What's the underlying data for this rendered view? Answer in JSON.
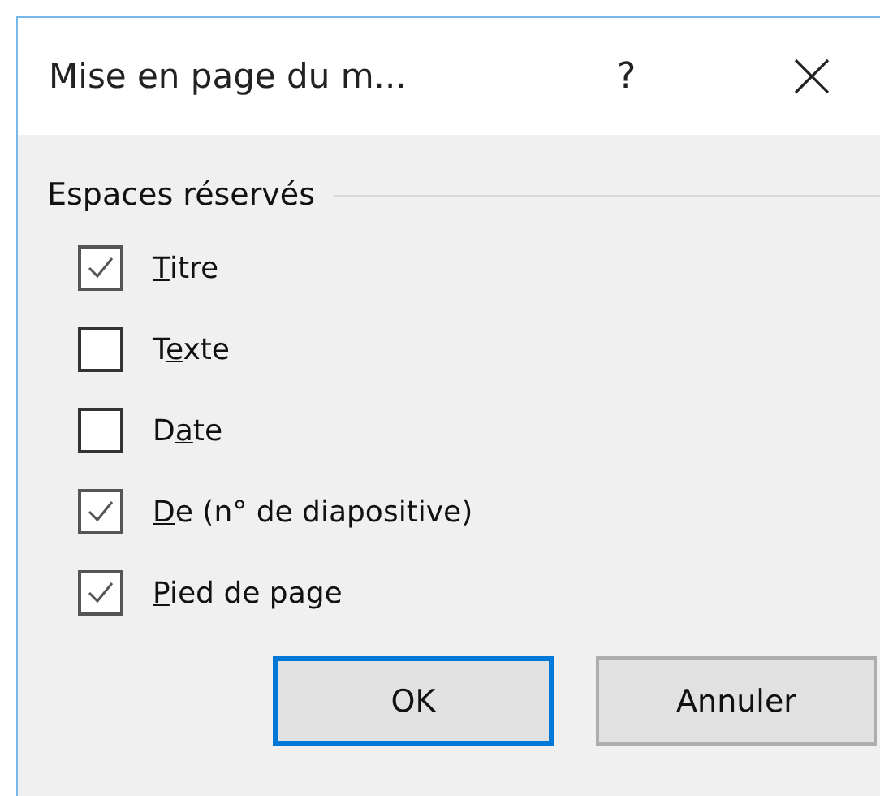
{
  "window": {
    "title": "Mise en page du m...",
    "help": "?"
  },
  "group": {
    "label": "Espaces réservés",
    "options": [
      {
        "key": "T",
        "after": "itre",
        "checked": true
      },
      {
        "before": "T",
        "key": "e",
        "after": "xte",
        "checked": false
      },
      {
        "before": "D",
        "key": "a",
        "after": "te",
        "checked": false
      },
      {
        "key": "D",
        "after": "e (n° de diapositive)",
        "checked": true
      },
      {
        "key": "P",
        "after": "ied de page",
        "checked": true
      }
    ]
  },
  "buttons": [
    {
      "label": "OK",
      "default": true
    },
    {
      "label": "Annuler",
      "default": false
    }
  ]
}
